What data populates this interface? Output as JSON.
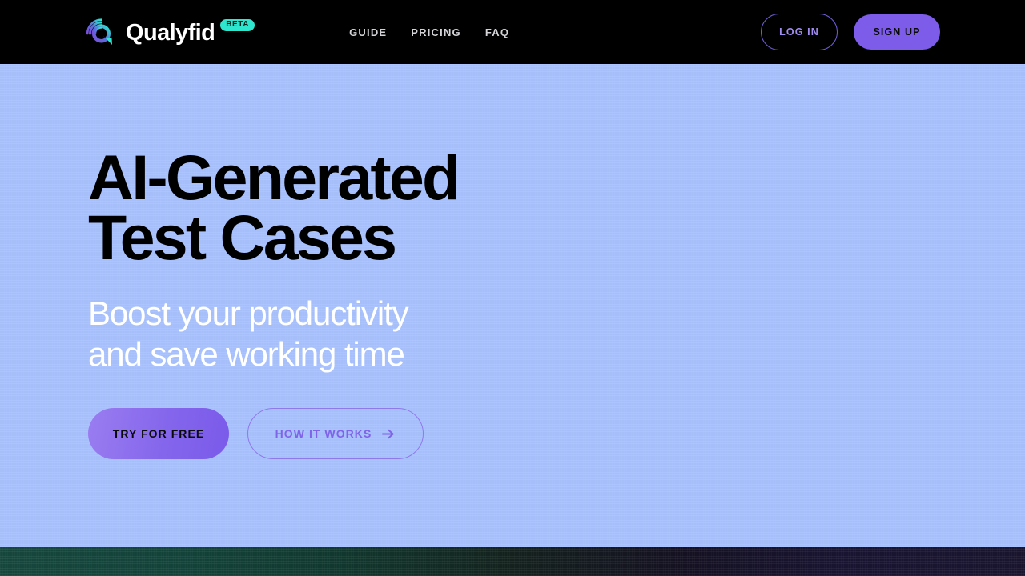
{
  "header": {
    "brand": {
      "logo_icon": "qualyfid-spiral-q-logo",
      "name": "Qualyfid",
      "badge": "BETA",
      "logo_gradient_start": "#7b4ddb",
      "logo_gradient_end": "#2ee6cd",
      "badge_bg": "#2ee6cd"
    },
    "nav": [
      {
        "label": "GUIDE"
      },
      {
        "label": "PRICING"
      },
      {
        "label": "FAQ"
      }
    ],
    "actions": {
      "login_label": "LOG IN",
      "signup_label": "SIGN UP",
      "login_border_color": "#6f5bd6",
      "signup_bg": "#7c5ce8"
    },
    "background": "#000000"
  },
  "hero": {
    "title": "AI-Generated\nTest Cases",
    "subtitle": "Boost your productivity\nand save working time",
    "background": "#aac3ff",
    "title_color": "#000000",
    "subtitle_color": "#ffffff",
    "cta": {
      "primary_label": "TRY FOR FREE",
      "secondary_label": "HOW IT WORKS",
      "secondary_icon": "arrow-right-icon",
      "primary_bg": "#8466ec",
      "secondary_color": "#7f63e8"
    }
  },
  "footer_band": {
    "gradient_start": "#17493f",
    "gradient_end": "#1b1630"
  }
}
